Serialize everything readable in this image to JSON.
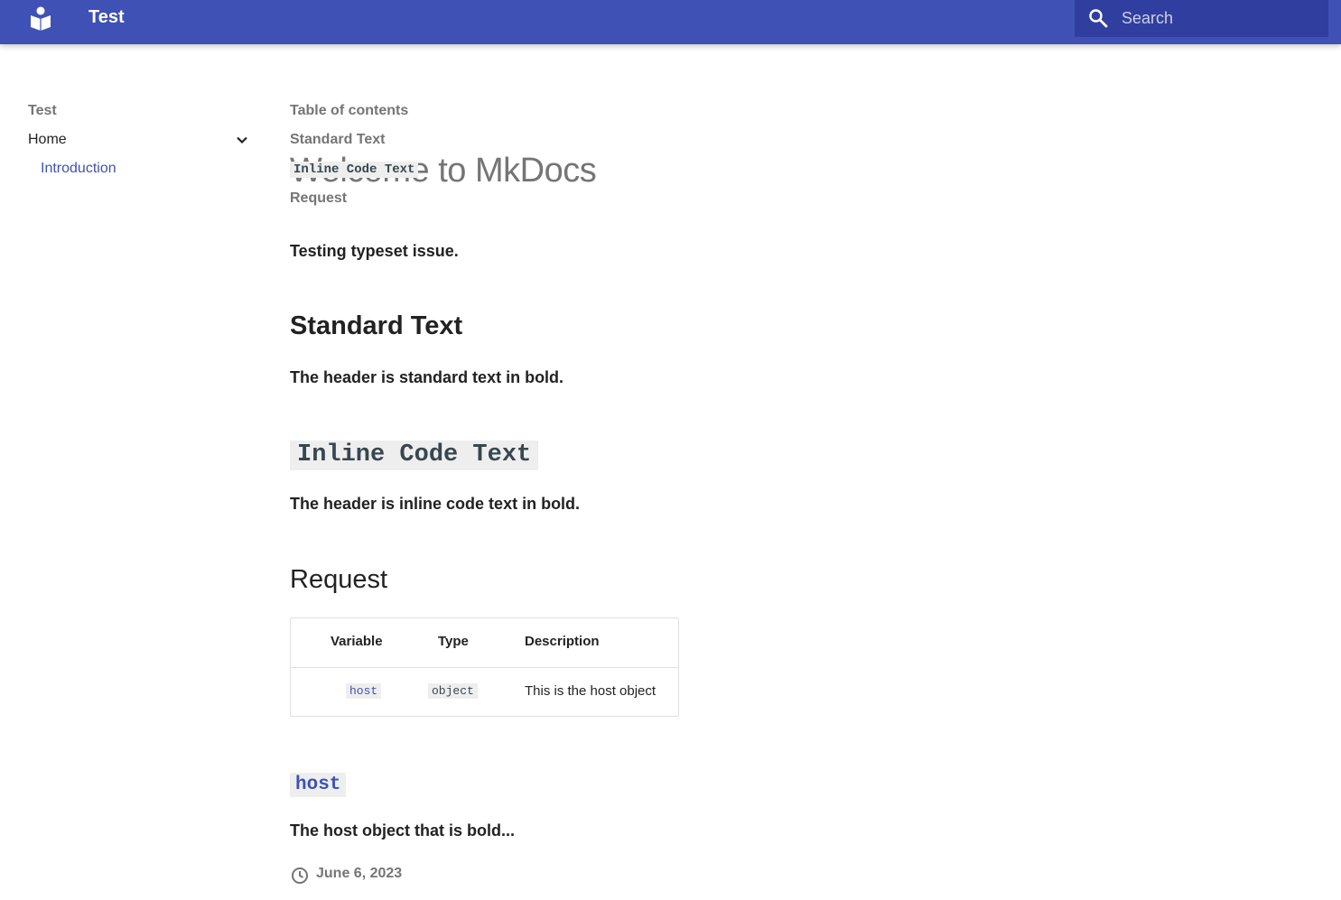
{
  "header": {
    "site_title": "Test",
    "search_placeholder": "Search",
    "logo_icon": "book-reader-icon",
    "search_icon": "magnifier-icon",
    "bar_color": "#3f51b5"
  },
  "sidebar": {
    "title": "Test",
    "items": [
      {
        "label": "Home",
        "icon": "chevron-down-icon"
      },
      {
        "label": "Introduction",
        "color": "#3f51b5"
      }
    ]
  },
  "toc": {
    "title": "Table of contents",
    "links": [
      "Standard Text",
      "Inline Code Text",
      "Request"
    ]
  },
  "main": {
    "title": "Welcome to MkDocs",
    "intro": "Testing typeset issue.",
    "sections": [
      {
        "heading": "Standard Text",
        "body": "The header is standard text in bold."
      },
      {
        "heading": "Inline Code Text",
        "body": "The header is inline code text in bold."
      },
      {
        "heading": "Request"
      }
    ],
    "table": {
      "headers": [
        "Variable",
        "Type",
        "Description"
      ],
      "rows": [
        {
          "variable": "host",
          "type": "object",
          "description": "This is the host object"
        }
      ]
    },
    "host_heading": "host",
    "host_body": "The host object that is bold...",
    "date": "June 6, 2023",
    "date_icon": "clock-icon"
  }
}
